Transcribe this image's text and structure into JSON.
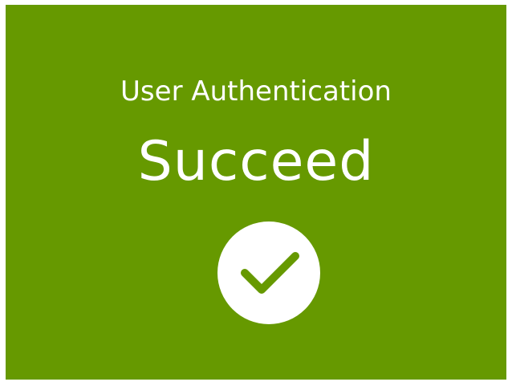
{
  "status": {
    "subtitle": "User Authentication",
    "title": "Succeed",
    "icon": "checkmark-icon"
  },
  "colors": {
    "background": "#669900",
    "text": "#ffffff",
    "icon_circle": "#ffffff",
    "icon_check": "#669900"
  }
}
